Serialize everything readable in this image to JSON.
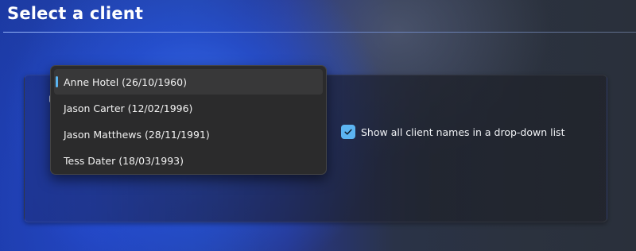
{
  "page": {
    "title": "Select a client"
  },
  "client_dropdown": {
    "selected_index": 0,
    "options": [
      {
        "label": "Anne Hotel (26/10/1960)"
      },
      {
        "label": "Jason Carter (12/02/1996)"
      },
      {
        "label": "Jason Matthews (28/11/1991)"
      },
      {
        "label": "Tess Dater (18/03/1993)"
      }
    ]
  },
  "show_all_option": {
    "label": "Show all client names in a drop-down list",
    "checked": true,
    "icon": "checkmark-icon"
  },
  "colors": {
    "accent": "#5cb4f2",
    "dropdown_bg": "#2b2b2c",
    "selected_row_bg": "#383839"
  }
}
